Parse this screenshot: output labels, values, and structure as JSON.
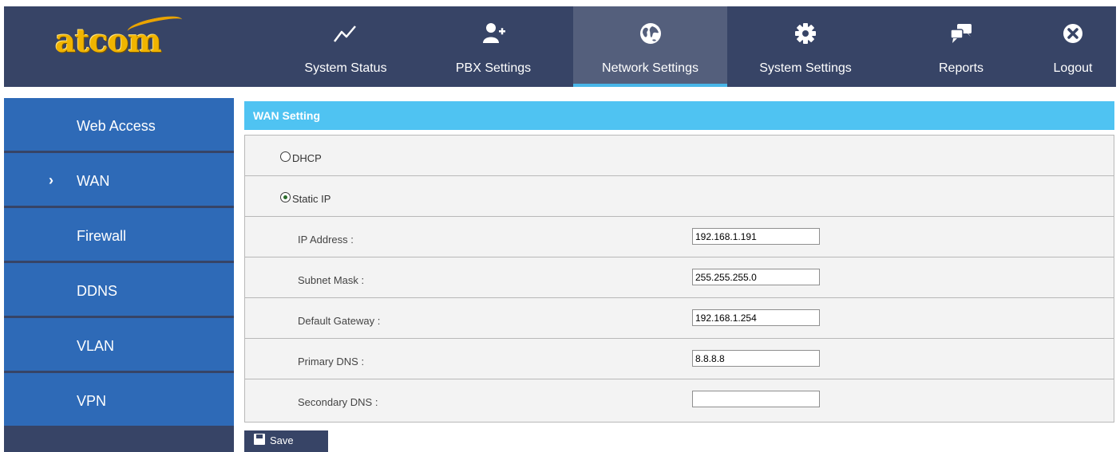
{
  "brand": {
    "logo_text": "atcom",
    "logo_color": "#f0b400"
  },
  "nav": {
    "items": [
      {
        "label": "System Status",
        "icon": "line-chart-icon",
        "active": false
      },
      {
        "label": "PBX Settings",
        "icon": "add-user-icon",
        "active": false
      },
      {
        "label": "Network Settings",
        "icon": "globe-icon",
        "active": true
      },
      {
        "label": "System Settings",
        "icon": "gear-icon",
        "active": false
      },
      {
        "label": "Reports",
        "icon": "chat-bubbles-icon",
        "active": false
      },
      {
        "label": "Logout",
        "icon": "close-circle-icon",
        "active": false
      }
    ]
  },
  "sidebar": {
    "items": [
      {
        "label": "Web Access",
        "active": false
      },
      {
        "label": "WAN",
        "active": true,
        "marker": "›"
      },
      {
        "label": "Firewall",
        "active": false
      },
      {
        "label": "DDNS",
        "active": false
      },
      {
        "label": "VLAN",
        "active": false
      },
      {
        "label": "VPN",
        "active": false
      }
    ]
  },
  "panel": {
    "title": "WAN Setting",
    "mode_options": [
      {
        "label": "DHCP",
        "checked": false
      },
      {
        "label": "Static IP",
        "checked": true
      }
    ],
    "fields": [
      {
        "label": "IP Address :",
        "value": "192.168.1.191"
      },
      {
        "label": "Subnet Mask :",
        "value": "255.255.255.0"
      },
      {
        "label": "Default Gateway :",
        "value": "192.168.1.254"
      },
      {
        "label": "Primary DNS :",
        "value": "8.8.8.8"
      },
      {
        "label": "Secondary DNS :",
        "value": ""
      }
    ],
    "save_label": "Save"
  },
  "colors": {
    "topbar": "#374466",
    "nav_active": "#545f7c",
    "nav_active_underline": "#49b6e8",
    "sidebar_item": "#2e6ab7",
    "panel_header": "#4fc3f2",
    "form_background": "#f3f3f3"
  }
}
